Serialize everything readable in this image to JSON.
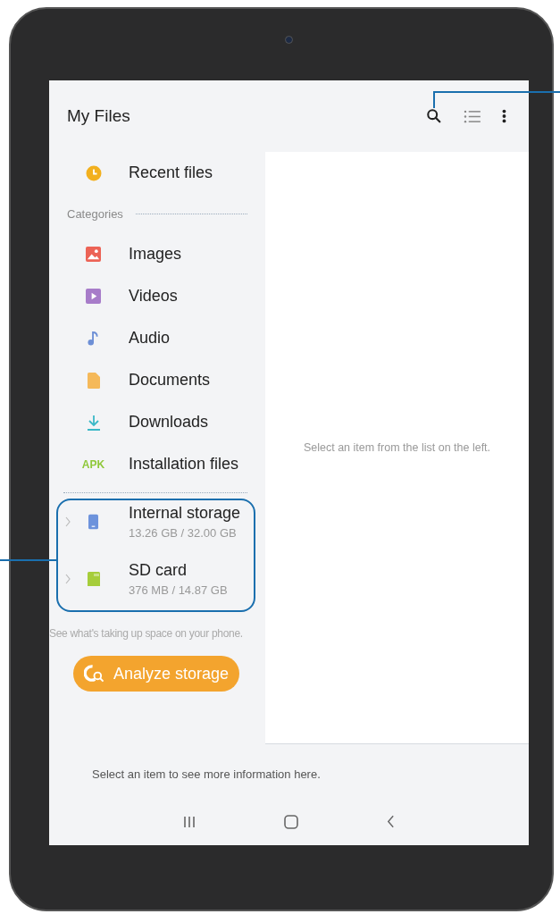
{
  "app_bar": {
    "title": "My Files"
  },
  "sidebar": {
    "recent": {
      "kind": "recent",
      "label": "Recent files"
    },
    "categories_label": "Categories",
    "categories": [
      {
        "kind": "images",
        "label": "Images"
      },
      {
        "kind": "videos",
        "label": "Videos"
      },
      {
        "kind": "audio",
        "label": "Audio"
      },
      {
        "kind": "documents",
        "label": "Documents"
      },
      {
        "kind": "downloads",
        "label": "Downloads"
      },
      {
        "kind": "apk",
        "label": "Installation files",
        "icon_text": "APK"
      }
    ],
    "storage": [
      {
        "kind": "phone",
        "name": "Internal storage",
        "usage": "13.26 GB / 32.00 GB"
      },
      {
        "kind": "sd",
        "name": "SD card",
        "usage": "376 MB / 14.87 GB"
      }
    ],
    "storage_hint": "See what's taking up space on your phone.",
    "analyze_button": "Analyze storage"
  },
  "content": {
    "placeholder": "Select an item from the list on the left."
  },
  "info_panel": {
    "text": "Select an item to see more information here."
  }
}
